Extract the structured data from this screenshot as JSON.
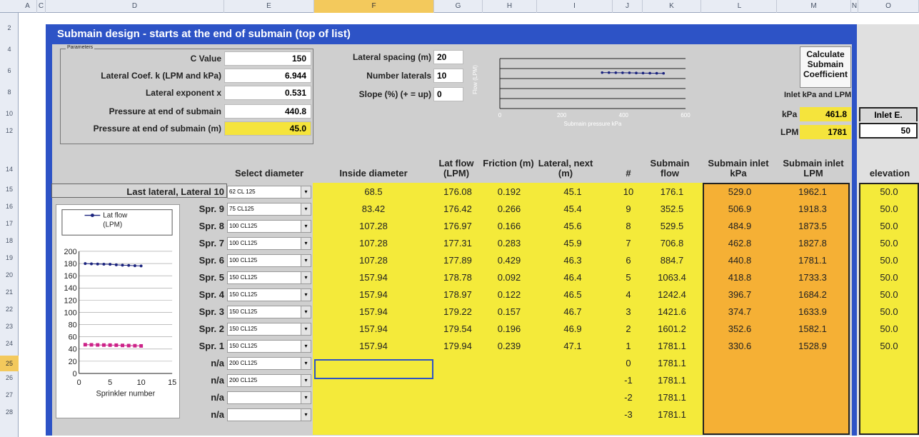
{
  "column_headers": [
    "A",
    "C",
    "D",
    "E",
    "F",
    "G",
    "H",
    "I",
    "J",
    "K",
    "L",
    "M",
    "N",
    "O"
  ],
  "row_headers": [
    "2",
    "4",
    "6",
    "8",
    "10",
    "12",
    "14",
    "15",
    "16",
    "17",
    "18",
    "19",
    "20",
    "21",
    "22",
    "23",
    "24",
    "25",
    "26",
    "27",
    "28"
  ],
  "title": "Submain design - starts at the end of submain (top of list)",
  "params": {
    "box_label": "Parameters",
    "rows": [
      {
        "label": "C Value",
        "value": "150"
      },
      {
        "label": "Lateral Coef. k (LPM and kPa)",
        "value": "6.944"
      },
      {
        "label": "Lateral exponent x",
        "value": "0.531"
      },
      {
        "label": "Pressure at end of submain",
        "value": "440.8"
      },
      {
        "label": "Pressure at end of submain (m)",
        "value": "45.0"
      }
    ]
  },
  "layout_params": [
    {
      "label": "Lateral spacing (m)",
      "value": "20"
    },
    {
      "label": "Number laterals",
      "value": "10"
    },
    {
      "label": "Slope (%) (+ = up)",
      "value": "0"
    }
  ],
  "calc_button": "Calculate Submain Coefficient",
  "inlet": {
    "label": "Inlet kPa and LPM",
    "kpa_label": "kPa",
    "kpa": "461.8",
    "lpm_label": "LPM",
    "lpm": "1781",
    "elev_label": "Inlet E.",
    "elev": "50"
  },
  "mini_chart_labels": {
    "y_label": "Flow (LPM)",
    "x_label": "Submain pressure kPa",
    "x_ticks": [
      "0",
      "200",
      "400",
      "600"
    ]
  },
  "table": {
    "headers": {
      "select": "Select diameter",
      "inside": "Inside diameter",
      "latflow": "Lat flow (LPM)",
      "friction": "Friction (m)",
      "lateral": "Lateral, next (m)",
      "num": "#",
      "subflow": "Submain flow",
      "subkpa": "Submain inlet kPa",
      "sublpm": "Submain inlet LPM",
      "elev": "elevation"
    },
    "rows": [
      {
        "label": "Last lateral, Lateral 10",
        "select": "62 CL 125",
        "inside": "68.5",
        "latflow": "176.08",
        "friction": "0.192",
        "lateral": "45.1",
        "num": "10",
        "subflow": "176.1",
        "subkpa": "529.0",
        "sublpm": "1962.1",
        "elev": "50.0"
      },
      {
        "label": "Spr. 9",
        "select": "75 CL125",
        "inside": "83.42",
        "latflow": "176.42",
        "friction": "0.266",
        "lateral": "45.4",
        "num": "9",
        "subflow": "352.5",
        "subkpa": "506.9",
        "sublpm": "1918.3",
        "elev": "50.0"
      },
      {
        "label": "Spr. 8",
        "select": "100 CL125",
        "inside": "107.28",
        "latflow": "176.97",
        "friction": "0.166",
        "lateral": "45.6",
        "num": "8",
        "subflow": "529.5",
        "subkpa": "484.9",
        "sublpm": "1873.5",
        "elev": "50.0"
      },
      {
        "label": "Spr. 7",
        "select": "100 CL125",
        "inside": "107.28",
        "latflow": "177.31",
        "friction": "0.283",
        "lateral": "45.9",
        "num": "7",
        "subflow": "706.8",
        "subkpa": "462.8",
        "sublpm": "1827.8",
        "elev": "50.0"
      },
      {
        "label": "Spr. 6",
        "select": "100 CL125",
        "inside": "107.28",
        "latflow": "177.89",
        "friction": "0.429",
        "lateral": "46.3",
        "num": "6",
        "subflow": "884.7",
        "subkpa": "440.8",
        "sublpm": "1781.1",
        "elev": "50.0"
      },
      {
        "label": "Spr. 5",
        "select": "150 CL125",
        "inside": "157.94",
        "latflow": "178.78",
        "friction": "0.092",
        "lateral": "46.4",
        "num": "5",
        "subflow": "1063.4",
        "subkpa": "418.8",
        "sublpm": "1733.3",
        "elev": "50.0"
      },
      {
        "label": "Spr. 4",
        "select": "150 CL125",
        "inside": "157.94",
        "latflow": "178.97",
        "friction": "0.122",
        "lateral": "46.5",
        "num": "4",
        "subflow": "1242.4",
        "subkpa": "396.7",
        "sublpm": "1684.2",
        "elev": "50.0"
      },
      {
        "label": "Spr. 3",
        "select": "150 CL125",
        "inside": "157.94",
        "latflow": "179.22",
        "friction": "0.157",
        "lateral": "46.7",
        "num": "3",
        "subflow": "1421.6",
        "subkpa": "374.7",
        "sublpm": "1633.9",
        "elev": "50.0"
      },
      {
        "label": "Spr. 2",
        "select": "150 CL125",
        "inside": "157.94",
        "latflow": "179.54",
        "friction": "0.196",
        "lateral": "46.9",
        "num": "2",
        "subflow": "1601.2",
        "subkpa": "352.6",
        "sublpm": "1582.1",
        "elev": "50.0"
      },
      {
        "label": "Spr. 1",
        "select": "150 CL125",
        "inside": "157.94",
        "latflow": "179.94",
        "friction": "0.239",
        "lateral": "47.1",
        "num": "1",
        "subflow": "1781.1",
        "subkpa": "330.6",
        "sublpm": "1528.9",
        "elev": "50.0"
      },
      {
        "label": "n/a",
        "select": "200 CL125",
        "inside": "",
        "latflow": "",
        "friction": "",
        "lateral": "",
        "num": "0",
        "subflow": "1781.1",
        "subkpa": "",
        "sublpm": "",
        "elev": ""
      },
      {
        "label": "n/a",
        "select": "200 CL125",
        "inside": "",
        "latflow": "",
        "friction": "",
        "lateral": "",
        "num": "-1",
        "subflow": "1781.1",
        "subkpa": "",
        "sublpm": "",
        "elev": ""
      },
      {
        "label": "n/a",
        "select": "",
        "inside": "",
        "latflow": "",
        "friction": "",
        "lateral": "",
        "num": "-2",
        "subflow": "1781.1",
        "subkpa": "",
        "sublpm": "",
        "elev": ""
      },
      {
        "label": "n/a",
        "select": "",
        "inside": "",
        "latflow": "",
        "friction": "",
        "lateral": "",
        "num": "-3",
        "subflow": "1781.1",
        "subkpa": "",
        "sublpm": "",
        "elev": ""
      }
    ]
  },
  "spr_chart": {
    "legend": "Lat flow (LPM)",
    "xlabel": "Sprinkler number",
    "y_ticks": [
      "200",
      "180",
      "160",
      "140",
      "120",
      "100",
      "80",
      "60",
      "40",
      "20",
      "0"
    ],
    "x_ticks": [
      "0",
      "5",
      "10",
      "15"
    ]
  },
  "chart_data": [
    {
      "type": "line",
      "title": "",
      "xlabel": "Sprinkler number",
      "ylabel": "",
      "ylim": [
        0,
        200
      ],
      "xlim": [
        0,
        15
      ],
      "series": [
        {
          "name": "Lat flow (LPM)",
          "x": [
            1,
            2,
            3,
            4,
            5,
            6,
            7,
            8,
            9,
            10
          ],
          "values": [
            179.94,
            179.54,
            179.22,
            178.97,
            178.78,
            177.89,
            177.31,
            176.97,
            176.42,
            176.08
          ],
          "color": "#1a237e"
        },
        {
          "values": [
            47.1,
            46.9,
            46.7,
            46.5,
            46.4,
            46.3,
            45.9,
            45.6,
            45.4,
            45.1
          ],
          "x": [
            1,
            2,
            3,
            4,
            5,
            6,
            7,
            8,
            9,
            10
          ],
          "color": "#cc2288"
        }
      ]
    }
  ],
  "colors": {
    "accent_blue": "#2d53c6",
    "yellow": "#f4ea3a",
    "orange": "#f5b035"
  }
}
